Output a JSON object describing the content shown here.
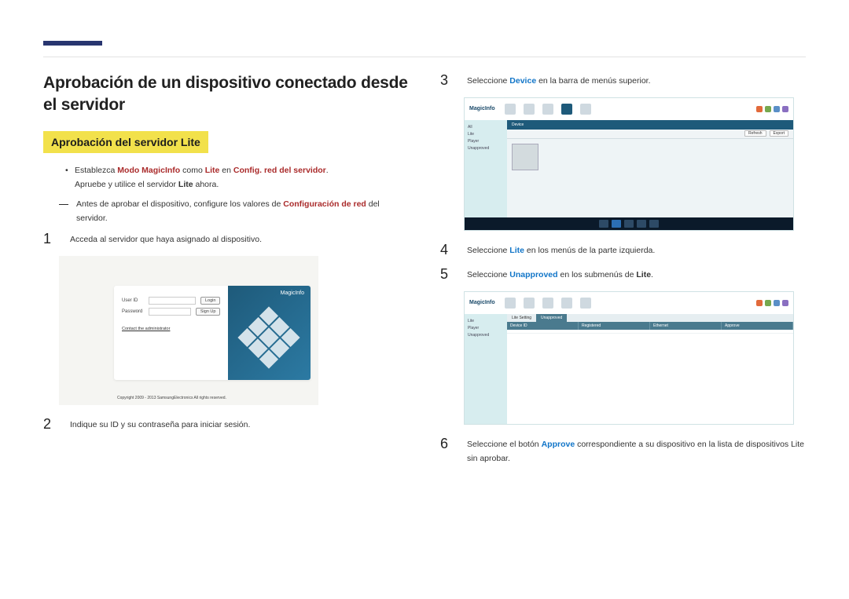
{
  "page": {
    "title": "Aprobación de un dispositivo conectado desde el servidor",
    "section_heading": "Aprobación del servidor Lite"
  },
  "intro": {
    "bullet1_pre": "Establezca ",
    "bullet1_m1": "Modo MagicInfo",
    "bullet1_mid1": " como ",
    "bullet1_m2": "Lite",
    "bullet1_mid2": " en ",
    "bullet1_m3": "Config. red del servidor",
    "bullet1_end": ".",
    "bullet2_pre": "Apruebe y utilice el servidor ",
    "bullet2_b": "Lite",
    "bullet2_end": " ahora.",
    "note_pre": "Antes de aprobar el dispositivo, configure los valores de ",
    "note_b": "Configuración de red",
    "note_end": " del servidor."
  },
  "steps": {
    "s1": "Acceda al servidor que haya asignado al dispositivo.",
    "s2": "Indique su ID y su contraseña para iniciar sesión.",
    "s3_pre": "Seleccione ",
    "s3_b": "Device",
    "s3_end": " en la barra de menús superior.",
    "s4_pre": "Seleccione ",
    "s4_b": "Lite",
    "s4_end": " en los menús de la parte izquierda.",
    "s5_pre": "Seleccione ",
    "s5_b1": "Unapproved",
    "s5_mid": " en los submenús de ",
    "s5_b2": "Lite",
    "s5_end": ".",
    "s6_pre": "Seleccione el botón ",
    "s6_b": "Approve",
    "s6_end": " correspondiente a su dispositivo en la lista de dispositivos Lite sin aprobar."
  },
  "login_mock": {
    "brand": "MagicInfo",
    "user_id": "User ID",
    "password": "Password",
    "login": "Login",
    "signup": "Sign Up",
    "contact": "Contact the administrator",
    "copyright": "Copyright 2009 - 2013 SamsungElectronics All rights reserved."
  },
  "app_mock": {
    "logo": "MagicInfo",
    "crumb1": "Device",
    "side_items": [
      "All",
      "Lite",
      "Player",
      "Unapproved"
    ],
    "toolbar_btn1": "Refresh",
    "toolbar_btn2": "Export",
    "table_heads": [
      "Device ID",
      "Registered",
      "Ethernet",
      "Approve"
    ],
    "subtab1": "Lite Setting",
    "subtab2": "Unapproved"
  }
}
